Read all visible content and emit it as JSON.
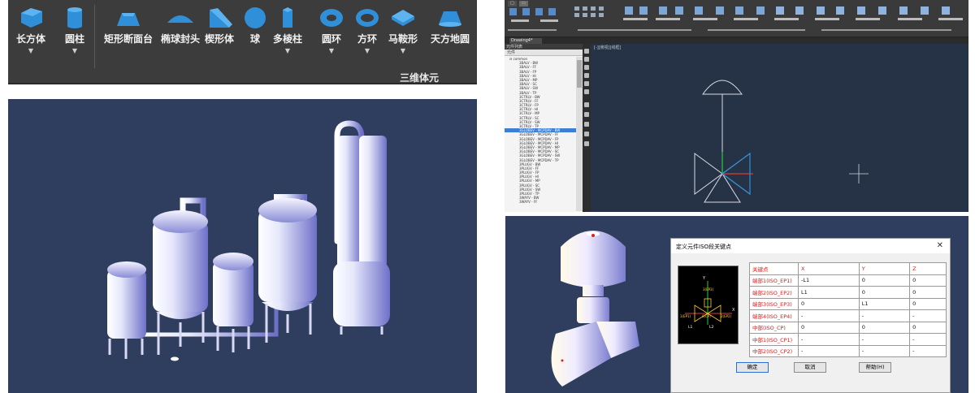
{
  "ribbon": {
    "tools": [
      {
        "label": "长方体",
        "icon": "cuboid-icon",
        "dropdown": true
      },
      {
        "label": "圆柱",
        "icon": "cylinder-icon",
        "dropdown": true
      },
      {
        "label": "矩形断面台",
        "icon": "frustum-icon",
        "dropdown": false
      },
      {
        "label": "椭球封头",
        "icon": "elliptical-head-icon",
        "dropdown": false
      },
      {
        "label": "楔形体",
        "icon": "wedge-icon",
        "dropdown": false
      },
      {
        "label": "球",
        "icon": "sphere-icon",
        "dropdown": false
      },
      {
        "label": "多棱柱",
        "icon": "prism-icon",
        "dropdown": true
      },
      {
        "label": "圆环",
        "icon": "torus-icon",
        "dropdown": true
      },
      {
        "label": "方环",
        "icon": "square-ring-icon",
        "dropdown": true
      },
      {
        "label": "马鞍形",
        "icon": "saddle-icon",
        "dropdown": true
      },
      {
        "label": "天方地圆",
        "icon": "square-to-round-icon",
        "dropdown": false
      }
    ],
    "dropdown_arrow": "▼",
    "group_title": "三维体元"
  },
  "cad": {
    "document_tab": "Drawing4*",
    "panel_title": "元件列表",
    "tree_header": "元件",
    "tree_items": [
      "⊟ common",
      "3BALV - BW",
      "3BALV - FF",
      "3BALV - FP",
      "3BALV - HI",
      "3BALV - MP",
      "3BALV - SC",
      "3BALV - SW",
      "3BALV - TP",
      "3CTRLV - BW",
      "3CTRLV - FF",
      "3CTRLV - FP",
      "3CTRLV - HI",
      "3CTRLV - MP",
      "3CTRLV - SC",
      "3CTRLV - SW",
      "3CTRLV - TP",
      "3GLOBEV - MCPDAV - BW",
      "3GLOBEV - MCPDAV - FF",
      "3GLOBEV - MCPDAV - FP",
      "3GLOBEV - MCPDAV - HI",
      "3GLOBEV - MCPDAV - MP",
      "3GLOBEV - MCPDAV - SC",
      "3GLOBEV - MCPDAV - SW",
      "3GLOBEV - MCPDAV - TP",
      "3PLUGV - BW",
      "3PLUGV - FF",
      "3PLUGV - FP",
      "3PLUGV - HI",
      "3PLUGV - MP",
      "3PLUGV - SC",
      "3PLUGV - SW",
      "3PLUGV - TP",
      "3WAYV - BW",
      "3WAYV - FF"
    ],
    "selected_index": 17,
    "viewport_label": "[-][俯视][线框]"
  },
  "dialog": {
    "title": "定义元件ISO段关键点",
    "close": "✕",
    "table_headers": [
      "关键点",
      "X",
      "Y",
      "Z"
    ],
    "table_rows": [
      [
        "端部1(ISO_EP1)",
        "-L1",
        "0",
        "0"
      ],
      [
        "端部2(ISO_EP2)",
        "L1",
        "0",
        "0"
      ],
      [
        "端部3(ISO_EP3)",
        "0",
        "L1",
        "0"
      ],
      [
        "端部4(ISO_EP4)",
        "-",
        "-",
        "-"
      ],
      [
        "中部(ISO_CP)",
        "0",
        "0",
        "0"
      ],
      [
        "中部1(ISO_CP1)",
        "-",
        "-",
        "-"
      ],
      [
        "中部2(ISO_CP2)",
        "-",
        "-",
        "-"
      ]
    ],
    "preview": {
      "y_label": "Y",
      "x_label": "X",
      "ep1": "1(EP1)",
      "ep2": "2(EP2)",
      "ep3": "3(EP3)",
      "cp": "0(CP)",
      "l1": "L1",
      "l2": "L2"
    },
    "buttons": {
      "ok": "确定",
      "cancel": "取消",
      "help": "帮助(H)"
    }
  },
  "colors": {
    "ribbon_bg": "#3c3c3c",
    "model_bg": "#2f3e5e",
    "cad_canvas": "#263245",
    "shape_blue": "#2f8fd8",
    "key_red": "#d42020"
  }
}
